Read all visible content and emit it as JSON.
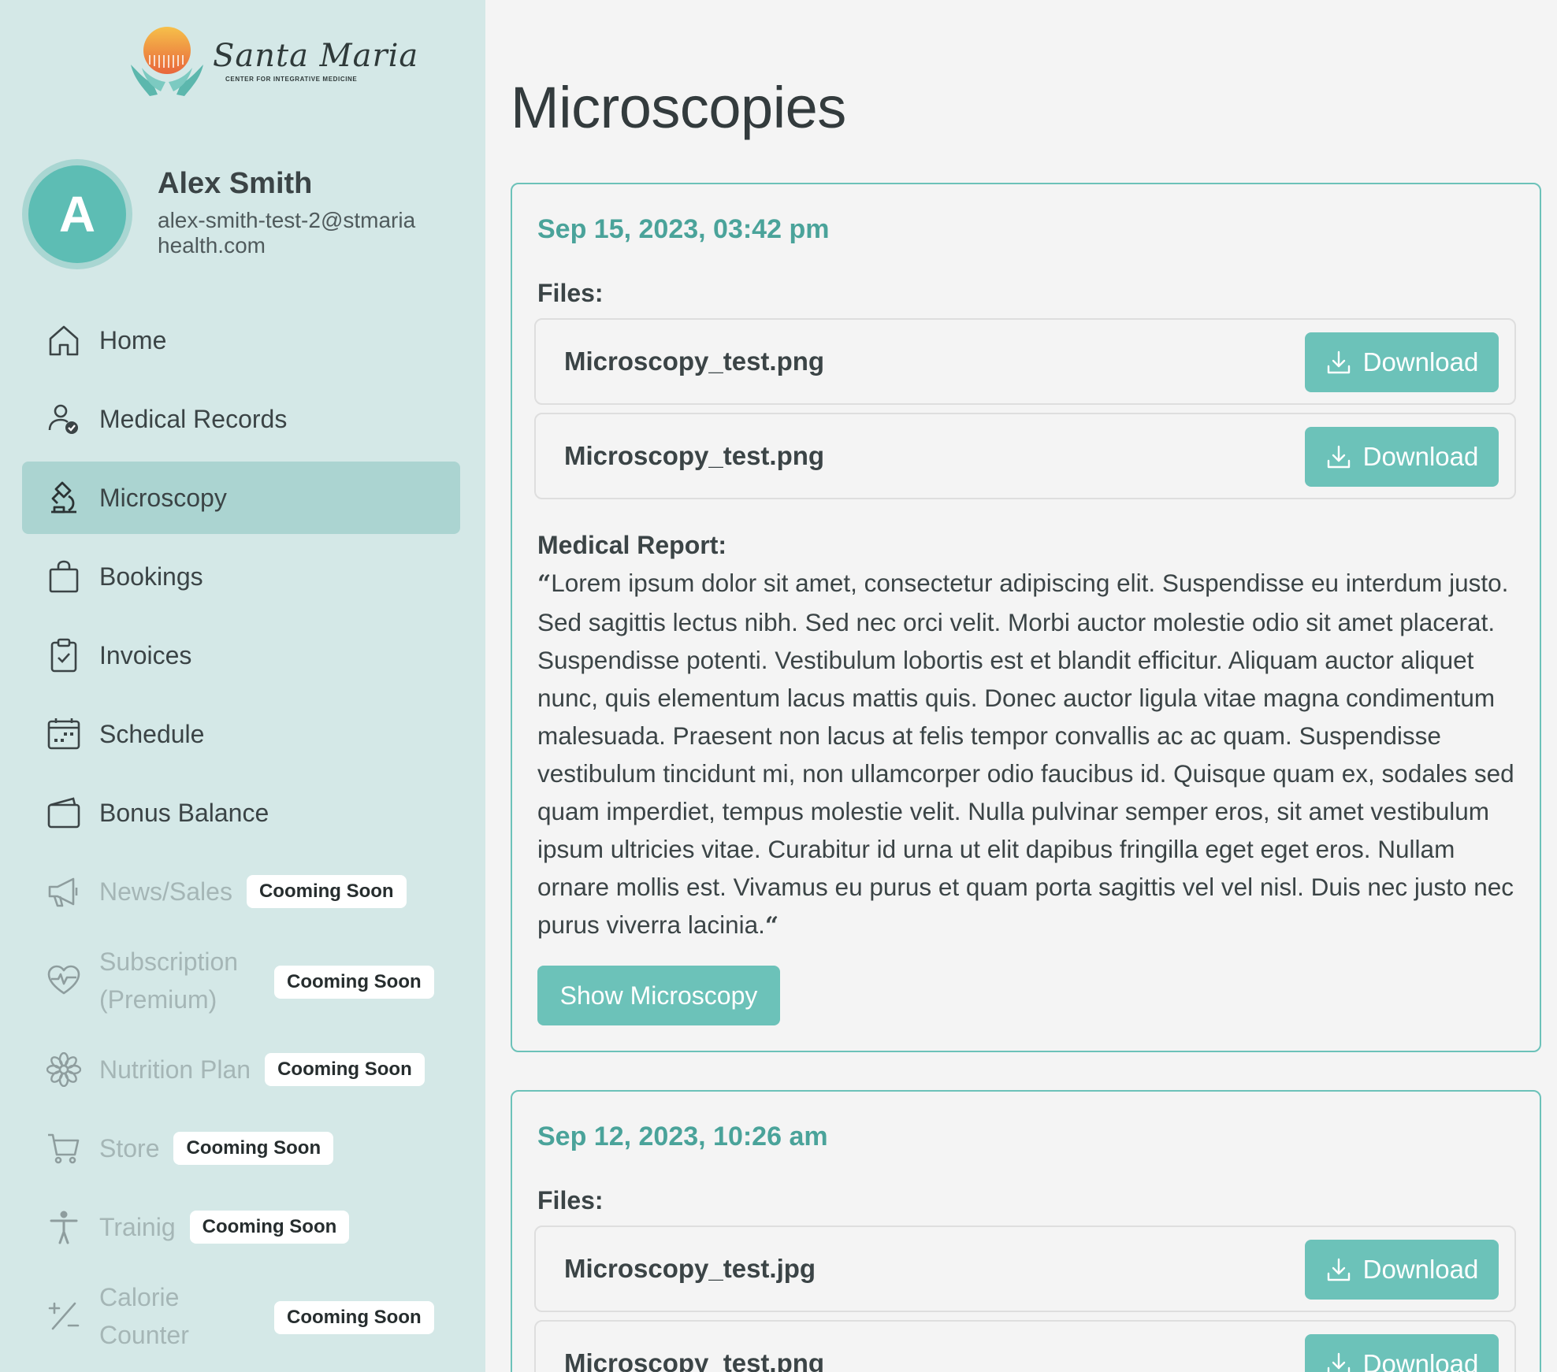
{
  "brand": {
    "name": "Santa Maria",
    "tagline": "CENTER FOR INTEGRATIVE MEDICINE"
  },
  "user": {
    "initial": "A",
    "name": "Alex Smith",
    "email": "alex-smith-test-2@stmariahealth.com"
  },
  "nav": [
    {
      "label": "Home",
      "icon": "home-icon"
    },
    {
      "label": "Medical Records",
      "icon": "user-check-icon"
    },
    {
      "label": "Microscopy",
      "icon": "microscope-icon",
      "active": true
    },
    {
      "label": "Bookings",
      "icon": "shopping-bag-icon"
    },
    {
      "label": "Invoices",
      "icon": "clipboard-check-icon"
    },
    {
      "label": "Schedule",
      "icon": "calendar-icon"
    },
    {
      "label": "Bonus Balance",
      "icon": "wallet-icon"
    },
    {
      "label": "News/Sales",
      "icon": "megaphone-icon",
      "badge": "Cooming Soon"
    },
    {
      "label": "Subscription (Premium)",
      "icon": "heart-pulse-icon",
      "badge": "Cooming Soon"
    },
    {
      "label": "Nutrition Plan",
      "icon": "flower-icon",
      "badge": "Cooming Soon"
    },
    {
      "label": "Store",
      "icon": "cart-icon",
      "badge": "Cooming Soon"
    },
    {
      "label": "Trainig",
      "icon": "person-icon",
      "badge": "Cooming Soon"
    },
    {
      "label": "Calorie Counter",
      "icon": "plus-minus-icon",
      "badge": "Cooming Soon"
    }
  ],
  "page": {
    "title": "Microscopies"
  },
  "labels": {
    "files": "Files:",
    "report": "Medical Report:",
    "download": "Download",
    "show": "Show Microscopy",
    "quote_mark": "“"
  },
  "records": [
    {
      "date": "Sep 15, 2023, 03:42 pm",
      "files": [
        "Microscopy_test.png",
        "Microscopy_test.png"
      ],
      "report": "Lorem ipsum dolor sit amet, consectetur adipiscing elit. Suspendisse eu interdum justo. Sed sagittis lectus nibh. Sed nec orci velit. Morbi auctor molestie odio sit amet placerat. Suspendisse potenti. Vestibulum lobortis est et blandit efficitur. Aliquam auctor aliquet nunc, quis elementum lacus mattis quis. Donec auctor ligula vitae magna condimentum malesuada. Praesent non lacus at felis tempor convallis ac ac quam. Suspendisse vestibulum tincidunt mi, non ullamcorper odio faucibus id. Quisque quam ex, sodales sed quam imperdiet, tempus molestie velit. Nulla pulvinar semper eros, sit amet vestibulum ipsum ultricies vitae. Curabitur id urna ut elit dapibus fringilla eget eget eros. Nullam ornare mollis est. Vivamus eu purus et quam porta sagittis vel vel nisl. Duis nec justo nec purus viverra lacinia."
    },
    {
      "date": "Sep 12, 2023, 10:26 am",
      "files": [
        "Microscopy_test.jpg",
        "Microscopy_test.png"
      ]
    }
  ],
  "colors": {
    "sidebar_bg": "#d4e8e7",
    "active_bg": "#abd4d1",
    "accent": "#6cc2b9",
    "date_text": "#4aa39a",
    "avatar": "#5dbdb4"
  }
}
